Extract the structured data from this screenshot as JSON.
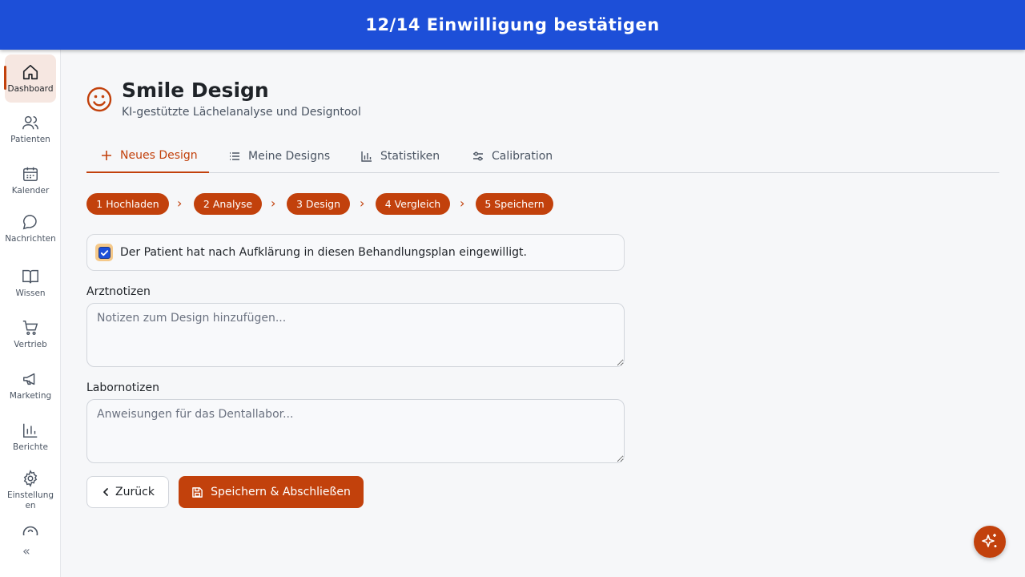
{
  "banner": {
    "title": "12/14 Einwilligung bestätigen"
  },
  "sidebar": {
    "items": [
      {
        "label": "Dashboard",
        "icon": "home-icon"
      },
      {
        "label": "Patienten",
        "icon": "users-icon"
      },
      {
        "label": "Kalender",
        "icon": "calendar-icon"
      },
      {
        "label": "Nachrichten",
        "icon": "message-icon"
      },
      {
        "label": "Wissen",
        "icon": "book-icon"
      },
      {
        "label": "Vertrieb",
        "icon": "cart-icon"
      },
      {
        "label": "Marketing",
        "icon": "megaphone-icon"
      },
      {
        "label": "Berichte",
        "icon": "bar-chart-icon"
      },
      {
        "label": "Einstellungen",
        "icon": "gear-icon"
      }
    ],
    "collapse_label": "«"
  },
  "header": {
    "title": "Smile Design",
    "subtitle": "KI-gestützte Lächelanalyse und Designtool"
  },
  "tabs": [
    {
      "label": "Neues Design",
      "icon": "plus-icon",
      "active": true
    },
    {
      "label": "Meine Designs",
      "icon": "list-icon"
    },
    {
      "label": "Statistiken",
      "icon": "bar-chart-icon"
    },
    {
      "label": "Calibration",
      "icon": "sliders-icon"
    }
  ],
  "steps": [
    {
      "label": "1 Hochladen"
    },
    {
      "label": "2 Analyse"
    },
    {
      "label": "3 Design"
    },
    {
      "label": "4 Vergleich"
    },
    {
      "label": "5 Speichern"
    }
  ],
  "consent": {
    "checked": true,
    "text": "Der Patient hat nach Aufklärung in diesen Behandlungsplan eingewilligt."
  },
  "doctor_notes": {
    "label": "Arztnotizen",
    "placeholder": "Notizen zum Design hinzufügen...",
    "value": ""
  },
  "lab_notes": {
    "label": "Labornotizen",
    "placeholder": "Anweisungen für das Dentallabor...",
    "value": ""
  },
  "actions": {
    "back_label": "Zurück",
    "save_label": "Speichern & Abschließen"
  },
  "colors": {
    "banner": "#1d4fd8",
    "accent": "#c2410c",
    "background": "#f6f7f9"
  }
}
